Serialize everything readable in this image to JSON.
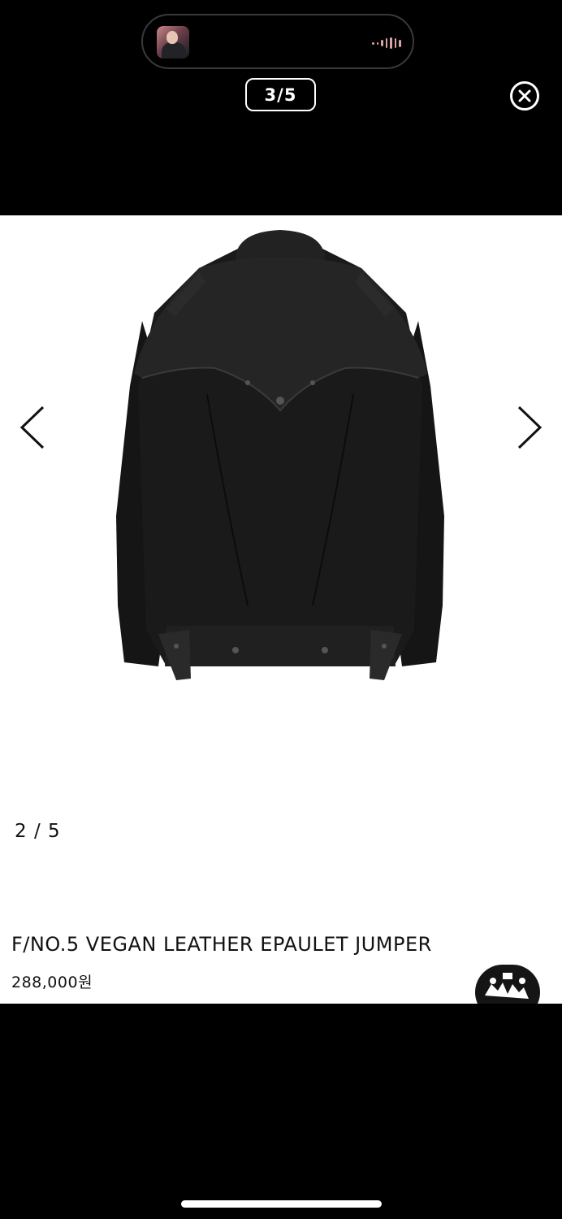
{
  "status_island": {
    "thumbnail_icon": "user-avatar-thumbnail",
    "audio_icon": "audio-waveform-icon",
    "accent_color": "#d9a6a3"
  },
  "viewer": {
    "counter": "3/5",
    "close_icon": "close-circle-icon"
  },
  "gallery": {
    "image_counter": "2 / 5",
    "prev_icon": "chevron-left-icon",
    "next_icon": "chevron-right-icon",
    "image_subject": "jacket-back-view"
  },
  "product": {
    "title": "F/NO.5 VEGAN LEATHER EPAULET JUMPER",
    "price": "288,000원",
    "brand_badge_icon": "brand-logo-badge"
  }
}
